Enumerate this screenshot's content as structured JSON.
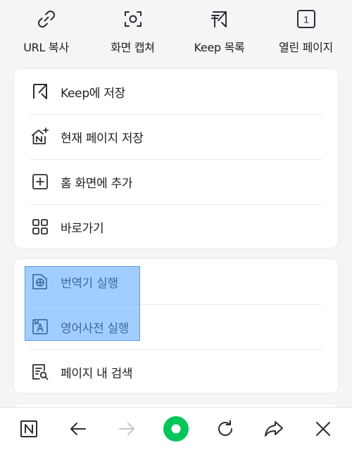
{
  "top_actions": [
    {
      "label": "URL 복사",
      "icon": "link-icon"
    },
    {
      "label": "화면 캡쳐",
      "icon": "screen-capture-icon"
    },
    {
      "label": "Keep 목록",
      "icon": "keep-list-icon"
    },
    {
      "label": "열린 페이지",
      "icon": "open-pages-icon",
      "count": "1"
    }
  ],
  "menu_group_1": [
    {
      "label": "Keep에 저장",
      "icon": "bookmark-icon"
    },
    {
      "label": "현재 페이지 저장",
      "icon": "save-page-icon"
    },
    {
      "label": "홈 화면에 추가",
      "icon": "add-home-icon"
    },
    {
      "label": "바로가기",
      "icon": "shortcuts-grid-icon"
    }
  ],
  "menu_group_2": [
    {
      "label": "번역기 실행",
      "icon": "translator-icon"
    },
    {
      "label": "영어사전 실행",
      "icon": "dictionary-icon"
    },
    {
      "label": "페이지 내 검색",
      "icon": "find-in-page-icon"
    }
  ],
  "bottom_bar": [
    {
      "icon": "naver-home-icon"
    },
    {
      "icon": "back-arrow-icon"
    },
    {
      "icon": "forward-arrow-icon",
      "disabled": true
    },
    {
      "icon": "green-dot-icon"
    },
    {
      "icon": "refresh-icon"
    },
    {
      "icon": "share-icon"
    },
    {
      "icon": "close-icon"
    }
  ],
  "colors": {
    "accent_green": "#03c75a",
    "icon_dark": "#2d2e33",
    "disabled": "#c4c6cc",
    "selection": "#55a5ff"
  }
}
